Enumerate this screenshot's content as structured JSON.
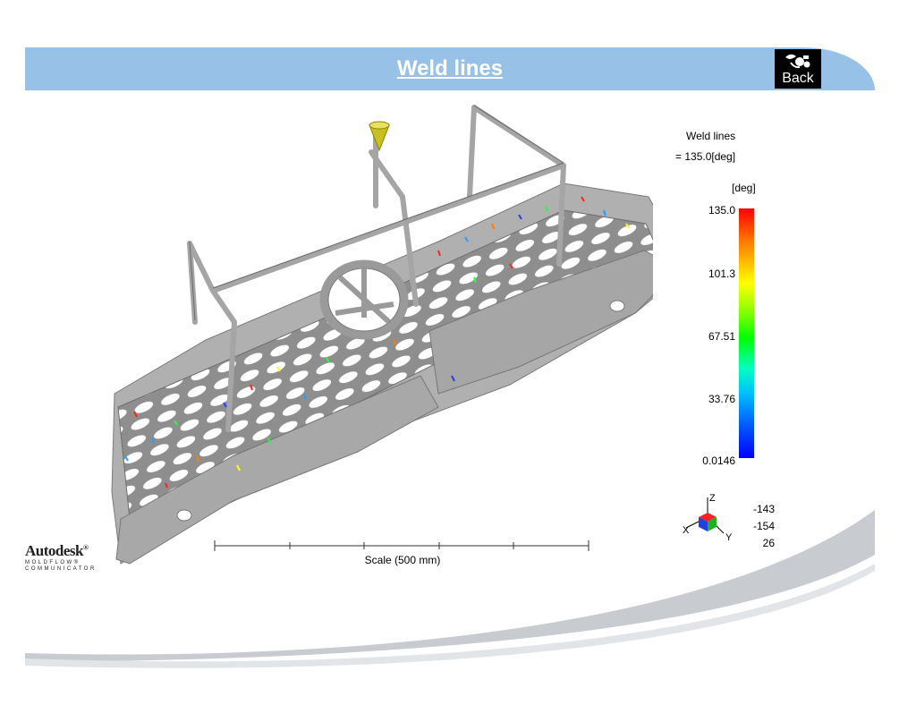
{
  "header": {
    "title": "Weld lines",
    "back_label": "Back",
    "back_icon": "doodle-icon"
  },
  "legend": {
    "result_name": "Weld lines",
    "result_value": "= 135.0[deg]",
    "unit": "[deg]",
    "ticks": [
      "135.0",
      "101.3",
      "67.51",
      "33.76",
      "0.0146"
    ],
    "gradient_colors": [
      "#ff0000",
      "#ffff00",
      "#00ff00",
      "#00c0ff",
      "#0000ff"
    ]
  },
  "axes": {
    "x_label": "X",
    "y_label": "Y",
    "z_label": "Z",
    "rotation": [
      "-143",
      "-154",
      "26"
    ]
  },
  "scale": {
    "label": "Scale (500 mm)"
  },
  "logo": {
    "main": "Autodesk",
    "registered": "®",
    "line1": "MOLDFLOW®",
    "line2": "COMMUNICATOR"
  }
}
